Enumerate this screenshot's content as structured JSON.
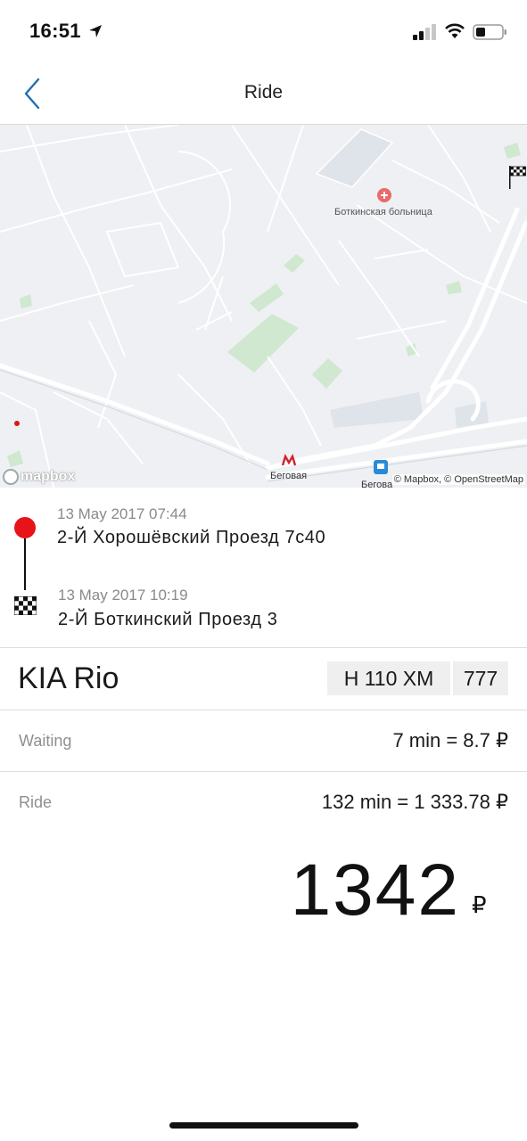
{
  "status_bar": {
    "time": "16:51"
  },
  "nav": {
    "title": "Ride"
  },
  "map": {
    "hospital_label": "Боткинская больница",
    "metro_label": "Беговая",
    "metro_label_2": "Бегова",
    "logo_text": "mapbox",
    "attribution": "© Mapbox, © OpenStreetMap"
  },
  "route": {
    "start": {
      "date": "13 May 2017 07:44",
      "address": "2-Й Хорошёвский Проезд 7с40"
    },
    "end": {
      "date": "13 May 2017 10:19",
      "address": "2-Й Боткинский Проезд 3"
    }
  },
  "car": {
    "name": "KIA Rio",
    "plate_number": "Н 110 ХМ",
    "plate_region": "777"
  },
  "fares": {
    "waiting_label": "Waiting",
    "waiting_value": "7 min = 8.7 ₽",
    "ride_label": "Ride",
    "ride_value": "132 min = 1 333.78 ₽"
  },
  "total": {
    "amount": "1342",
    "currency": "₽"
  },
  "colors": {
    "start_marker": "#e8121a",
    "nav_accent": "#1f6fb2",
    "map_bg": "#eef0f3",
    "park_green": "#cfe8cf"
  }
}
